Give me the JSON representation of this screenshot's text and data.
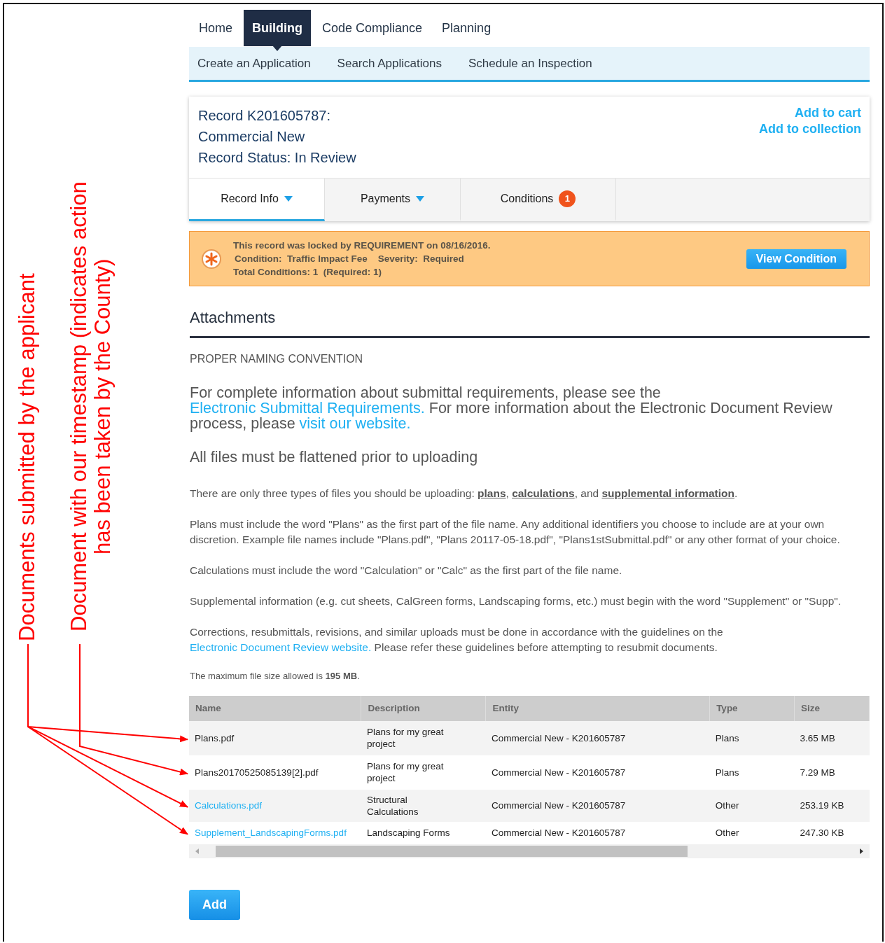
{
  "annotations": [
    {
      "text": "Documents submitted by the applicant"
    },
    {
      "text": "Document with our timestamp (indicates action has been taken by the County)"
    }
  ],
  "nav": {
    "tabs": [
      {
        "label": "Home",
        "selected": false
      },
      {
        "label": "Building",
        "selected": true
      },
      {
        "label": "Code Compliance",
        "selected": false
      },
      {
        "label": "Planning",
        "selected": false
      }
    ]
  },
  "subnav": {
    "items": [
      "Create an Application",
      "Search Applications",
      "Schedule an Inspection"
    ]
  },
  "record": {
    "lines": [
      "Record K201605787:",
      "Commercial New",
      "Record Status: In Review"
    ],
    "actions": [
      "Add to cart",
      "Add to collection"
    ]
  },
  "record_tabs": [
    {
      "label": "Record Info",
      "selected": true,
      "kind": "dropdown"
    },
    {
      "label": "Payments",
      "selected": false,
      "kind": "dropdown"
    },
    {
      "label": "Conditions",
      "selected": false,
      "kind": "count",
      "count": "1"
    }
  ],
  "alert": {
    "lines": [
      "This record was locked by REQUIREMENT on 08/16/2016.",
      "Condition:  Traffic Impact Fee    Severity:  Required",
      "Total Conditions: 1  (Required: 1)"
    ],
    "button": "View Condition"
  },
  "attachments": {
    "title": "Attachments",
    "subtitle": "PROPER NAMING CONVENTION",
    "paragraphs": [
      {
        "kind": "large",
        "segments": [
          {
            "kind": "text",
            "text": "For complete information about submittal requirements, please see the "
          },
          {
            "kind": "link",
            "text": "Electronic Submittal Requirements."
          },
          {
            "kind": "text",
            "text": " For more information about the Electronic Document Review process, please "
          },
          {
            "kind": "link",
            "text": "visit our website."
          }
        ]
      },
      {
        "kind": "large",
        "segments": [
          {
            "kind": "text",
            "text": "All files must be flattened prior to uploading"
          }
        ]
      },
      {
        "kind": "normal",
        "segments": [
          {
            "kind": "text",
            "text": "There are only three types of files you should be uploading: "
          },
          {
            "kind": "term",
            "text": "plans"
          },
          {
            "kind": "text",
            "text": ", "
          },
          {
            "kind": "term",
            "text": "calculations"
          },
          {
            "kind": "text",
            "text": ", and "
          },
          {
            "kind": "term",
            "text": "supplemental information"
          },
          {
            "kind": "text",
            "text": "."
          }
        ]
      },
      {
        "kind": "normal",
        "segments": [
          {
            "kind": "text",
            "text": "Plans must include the word \"Plans\" as the first part of the file name. Any additional identifiers you choose to include are at your own discretion. Example file names include \"Plans.pdf\", \"Plans 20117-05-18.pdf\", \"Plans1stSubmittal.pdf\" or any other format of your choice."
          }
        ]
      },
      {
        "kind": "normal",
        "segments": [
          {
            "kind": "text",
            "text": "Calculations must include the word \"Calculation\" or \"Calc\" as the first part of the file name."
          }
        ]
      },
      {
        "kind": "normal",
        "segments": [
          {
            "kind": "text",
            "text": "Supplemental information (e.g. cut sheets, CalGreen forms, Landscaping forms, etc.) must begin with the word \"Supplement\" or \"Supp\"."
          }
        ]
      },
      {
        "kind": "normal",
        "segments": [
          {
            "kind": "text",
            "text": "Corrections, resubmittals, revisions, and similar uploads must be done in accordance with the guidelines on the "
          },
          {
            "kind": "link",
            "text": "Electronic Document Review website."
          },
          {
            "kind": "text",
            "text": " Please refer these guidelines before attempting to resubmit documents."
          }
        ]
      },
      {
        "kind": "small",
        "segments": [
          {
            "kind": "text",
            "text": "The maximum file size allowed is **195 MB**."
          }
        ]
      }
    ]
  },
  "table": {
    "columns": [
      "Name",
      "Description",
      "Entity",
      "Type",
      "Size"
    ],
    "rows": [
      {
        "linked": false,
        "cells": [
          "Plans.pdf",
          "Plans for my great project",
          "Commercial New - K201605787",
          "Plans",
          "3.65 MB"
        ]
      },
      {
        "linked": false,
        "cells": [
          "Plans20170525085139[2].pdf",
          "Plans for my great project",
          "Commercial New - K201605787",
          "Plans",
          "7.29 MB"
        ]
      },
      {
        "linked": true,
        "cells": [
          "Calculations.pdf",
          "Structural Calculations",
          "Commercial New - K201605787",
          "Other",
          "253.19 KB"
        ]
      },
      {
        "linked": true,
        "cells": [
          "Supplement_LandscapingForms.pdf",
          "Landscaping Forms",
          "Commercial New - K201605787",
          "Other",
          "247.30 KB"
        ]
      }
    ]
  },
  "add_button": "Add"
}
